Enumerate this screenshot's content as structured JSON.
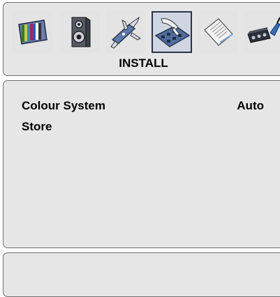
{
  "menu": {
    "title": "INSTALL",
    "icons": [
      {
        "name": "picture-icon",
        "selected": false
      },
      {
        "name": "speaker-icon",
        "selected": false
      },
      {
        "name": "swiss-knife-icon",
        "selected": false
      },
      {
        "name": "install-hand-remote-icon",
        "selected": true
      },
      {
        "name": "document-icon",
        "selected": false
      },
      {
        "name": "connector-plug-icon",
        "selected": false
      }
    ]
  },
  "settings": [
    {
      "label": "Colour System",
      "value": "Auto"
    },
    {
      "label": "Store",
      "value": ""
    }
  ],
  "colors": {
    "panel_bg": "#e6e6e6",
    "panel_border": "#6f6f6f",
    "selected_tile": "#cfd6e2"
  }
}
